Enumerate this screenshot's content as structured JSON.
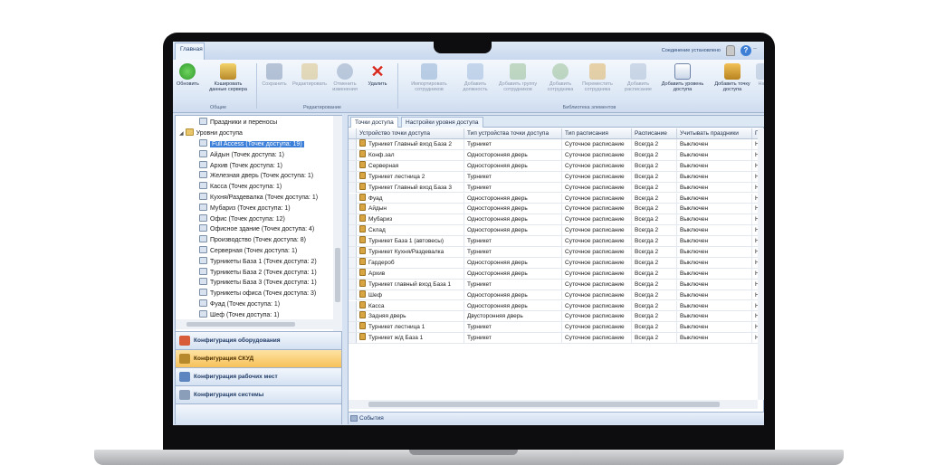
{
  "window": {
    "tab_home": "Главная",
    "connection_status": "Соединение установлено"
  },
  "ribbon": {
    "groups": {
      "general": "Общие",
      "editing": "Редактирование",
      "employee_library": "Библиотека элементов"
    },
    "buttons": {
      "refresh": "Обновить",
      "cache": "Кэшировать данные сервера",
      "save": "Сохранить",
      "edit": "Редактировать",
      "undo": "Отменить изменения",
      "delete": "Удалить",
      "import": "Импортировать сотрудников",
      "add_position": "Добавить должность",
      "add_group": "Добавить группу сотрудников",
      "add_employee": "Добавить сотрудника",
      "move_employee": "Переместить сотрудника",
      "add_schedule": "Добавить расписание",
      "add_access_level": "Добавить уровень доступа",
      "add_access_point": "Добавить точку доступа",
      "next_cut": "На"
    }
  },
  "tree": {
    "holidays": "Праздники и переносы",
    "access_levels": "Уровни доступа",
    "items": [
      "Full Access (Точек доступа: 19)",
      "Айдын (Точек доступа: 1)",
      "Архив (Точек доступа: 1)",
      "Железная дверь (Точек доступа: 1)",
      "Касса (Точек доступа: 1)",
      "Кухня/Раздевалка (Точек доступа: 1)",
      "Мубариз (Точек доступа: 1)",
      "Офис (Точек доступа: 12)",
      "Офисное здание (Точек доступа: 4)",
      "Производство (Точек доступа: 8)",
      "Серверная (Точек доступа: 1)",
      "Турникеты База 1 (Точек доступа: 2)",
      "Турникеты База 2 (Точек доступа: 1)",
      "Турникеты База 3 (Точек доступа: 1)",
      "Турникеты офиса (Точек доступа: 3)",
      "Фуад (Точек доступа: 1)",
      "Шеф (Точек доступа: 1)"
    ]
  },
  "nav": {
    "equipment": "Конфигурация оборудования",
    "acs": "Конфигурация СКУД",
    "workplaces": "Конфигурация рабочих мест",
    "system": "Конфигурация системы"
  },
  "right_tabs": {
    "access_points": "Точки доступа",
    "level_settings": "Настройки уровня доступа"
  },
  "table": {
    "headers": [
      "Устройство точки доступа",
      "Тип устройства точки доступа",
      "Тип расписания",
      "Расписание",
      "Учитывать праздники",
      "П"
    ],
    "rows": [
      [
        "Турникет Главный вход База 2",
        "Турникет",
        "Суточное расписание",
        "Всегда 2",
        "Выключен",
        "Н"
      ],
      [
        "Конф.зал",
        "Односторонняя дверь",
        "Суточное расписание",
        "Всегда 2",
        "Выключен",
        "Н"
      ],
      [
        "Серверная",
        "Односторонняя дверь",
        "Суточное расписание",
        "Всегда 2",
        "Выключен",
        "Н"
      ],
      [
        "Турникет лестница 2",
        "Турникет",
        "Суточное расписание",
        "Всегда 2",
        "Выключен",
        "Н"
      ],
      [
        "Турникет Главный вход База 3",
        "Турникет",
        "Суточное расписание",
        "Всегда 2",
        "Выключен",
        "Н"
      ],
      [
        "Фуад",
        "Односторонняя дверь",
        "Суточное расписание",
        "Всегда 2",
        "Выключен",
        "Н"
      ],
      [
        "Айдын",
        "Односторонняя дверь",
        "Суточное расписание",
        "Всегда 2",
        "Выключен",
        "Н"
      ],
      [
        "Мубариз",
        "Односторонняя дверь",
        "Суточное расписание",
        "Всегда 2",
        "Выключен",
        "Н"
      ],
      [
        "Склад",
        "Односторонняя дверь",
        "Суточное расписание",
        "Всегда 2",
        "Выключен",
        "Н"
      ],
      [
        "Турникет База 1 (автовесы)",
        "Турникет",
        "Суточное расписание",
        "Всегда 2",
        "Выключен",
        "Н"
      ],
      [
        "Турникет Кухня/Раздевалка",
        "Турникет",
        "Суточное расписание",
        "Всегда 2",
        "Выключен",
        "Н"
      ],
      [
        "Гардероб",
        "Односторонняя дверь",
        "Суточное расписание",
        "Всегда 2",
        "Выключен",
        "Н"
      ],
      [
        "Архив",
        "Односторонняя дверь",
        "Суточное расписание",
        "Всегда 2",
        "Выключен",
        "Н"
      ],
      [
        "Турникет главный вход База 1",
        "Турникет",
        "Суточное расписание",
        "Всегда 2",
        "Выключен",
        "Н"
      ],
      [
        "Шеф",
        "Односторонняя дверь",
        "Суточное расписание",
        "Всегда 2",
        "Выключен",
        "Н"
      ],
      [
        "Касса",
        "Односторонняя дверь",
        "Суточное расписание",
        "Всегда 2",
        "Выключен",
        "Н"
      ],
      [
        "Задняя дверь",
        "Двусторонняя дверь",
        "Суточное расписание",
        "Всегда 2",
        "Выключен",
        "Н"
      ],
      [
        "Турникет лестница 1",
        "Турникет",
        "Суточное расписание",
        "Всегда 2",
        "Выключен",
        "Н"
      ],
      [
        "Турникет ж/д База 1",
        "Турникет",
        "Суточное расписание",
        "Всегда 2",
        "Выключен",
        "Н"
      ]
    ]
  },
  "events_label": "События"
}
